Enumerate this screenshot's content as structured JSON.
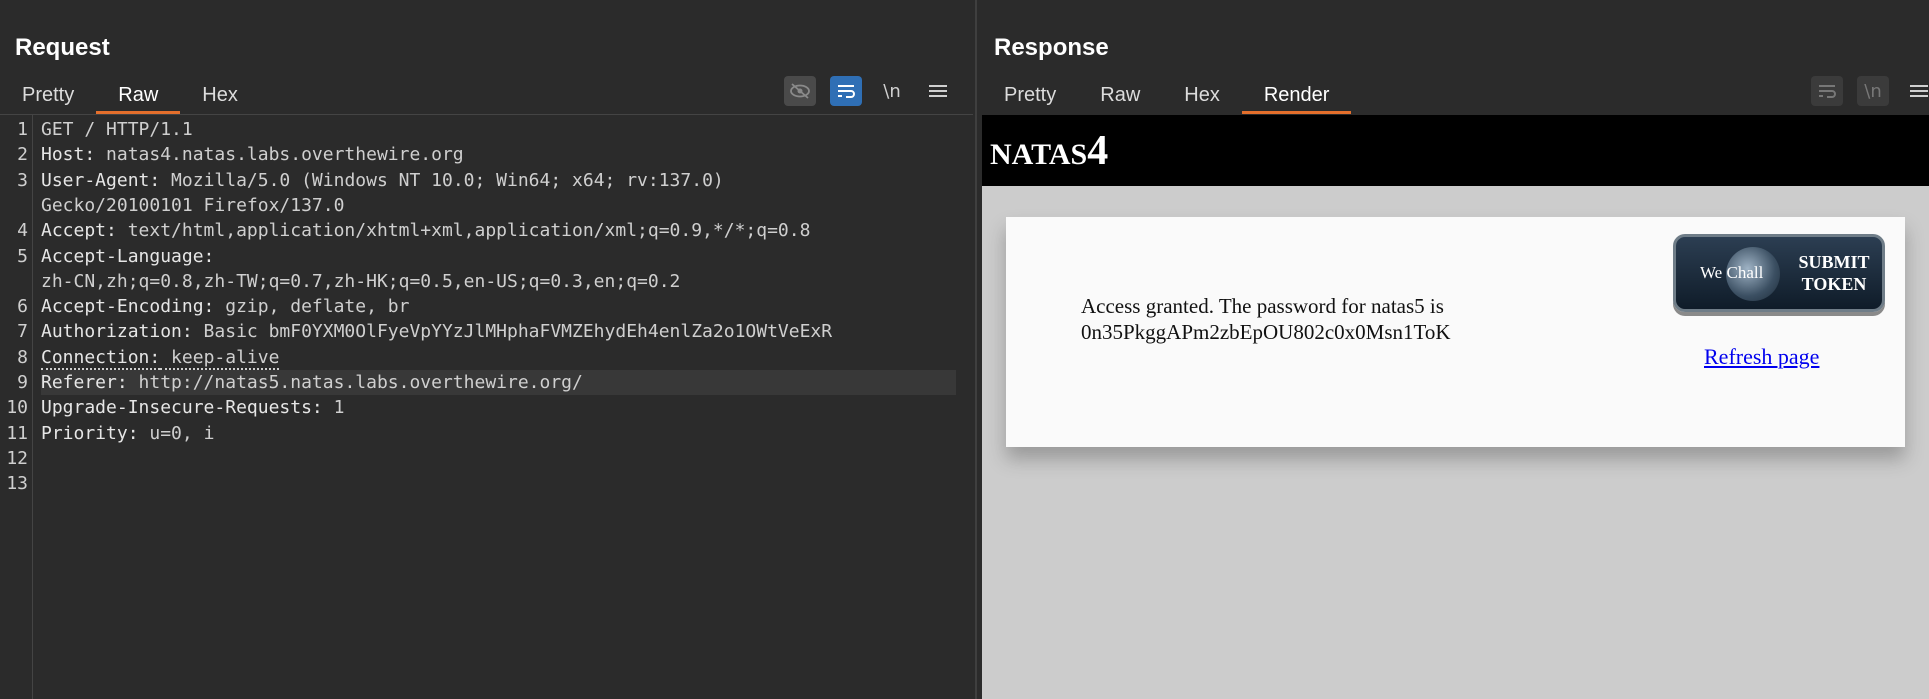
{
  "request": {
    "title": "Request",
    "tabs": [
      {
        "label": "Pretty",
        "active": false
      },
      {
        "label": "Raw",
        "active": true
      },
      {
        "label": "Hex",
        "active": false
      }
    ],
    "toolbar": {
      "hide_icon": "eye-off-icon",
      "wrap_icon": "word-wrap-icon",
      "newline_label": "\\n",
      "menu_icon": "hamburger-menu-icon"
    },
    "lines": [
      {
        "n": "1",
        "key": "",
        "value": "GET / HTTP/1.1"
      },
      {
        "n": "2",
        "key": "Host:",
        "value": " natas4.natas.labs.overthewire.org"
      },
      {
        "n": "3",
        "key": "User-Agent:",
        "value": " Mozilla/5.0 (Windows NT 10.0; Win64; x64; rv:137.0)"
      },
      {
        "n": "",
        "key": "",
        "value": "Gecko/20100101 Firefox/137.0"
      },
      {
        "n": "4",
        "key": "Accept:",
        "value": " text/html,application/xhtml+xml,application/xml;q=0.9,*/*;q=0.8"
      },
      {
        "n": "5",
        "key": "Accept-Language:",
        "value": ""
      },
      {
        "n": "",
        "key": "",
        "value": "zh-CN,zh;q=0.8,zh-TW;q=0.7,zh-HK;q=0.5,en-US;q=0.3,en;q=0.2"
      },
      {
        "n": "6",
        "key": "Accept-Encoding:",
        "value": " gzip, deflate, br"
      },
      {
        "n": "7",
        "key": "Authorization:",
        "value": " Basic bmF0YXM0OlFyeVpYYzJlMHphaFVMZEhydEh4enlZa2o1OWtVeExR"
      },
      {
        "n": "8",
        "key": "Connection:",
        "value": " keep-alive"
      },
      {
        "n": "9",
        "key": "Referer:",
        "value": " http://natas5.natas.labs.overthewire.org/"
      },
      {
        "n": "10",
        "key": "Upgrade-Insecure-Requests:",
        "value": " 1"
      },
      {
        "n": "11",
        "key": "Priority:",
        "value": " u=0, i"
      },
      {
        "n": "12",
        "key": "",
        "value": ""
      },
      {
        "n": "13",
        "key": "",
        "value": ""
      }
    ]
  },
  "response": {
    "title": "Response",
    "tabs": [
      {
        "label": "Pretty",
        "active": false
      },
      {
        "label": "Raw",
        "active": false
      },
      {
        "label": "Hex",
        "active": false
      },
      {
        "label": "Render",
        "active": true
      }
    ],
    "toolbar": {
      "wrap_icon": "word-wrap-icon",
      "newline_label": "\\n",
      "menu_icon": "hamburger-menu-icon"
    },
    "render": {
      "site_title_prefix": "NATAS",
      "site_title_number": "4",
      "message_line1": "Access granted. The password for natas5 is",
      "message_line2": "0n35PkggAPm2zbEpOU802c0x0Msn1ToK",
      "token_button_brand": "We Chall",
      "token_button_line1": "SUBMIT",
      "token_button_line2": "TOKEN",
      "refresh_link": "Refresh page"
    }
  },
  "layout_toggles": [
    {
      "icon": "split-vertical-icon",
      "active": true
    },
    {
      "icon": "split-horizontal-icon",
      "active": false
    },
    {
      "icon": "single-pane-icon",
      "active": false
    }
  ],
  "colors": {
    "accent_tab": "#e46f2c",
    "active_toggle": "#2f6fb5",
    "background": "#2b2b2b"
  }
}
